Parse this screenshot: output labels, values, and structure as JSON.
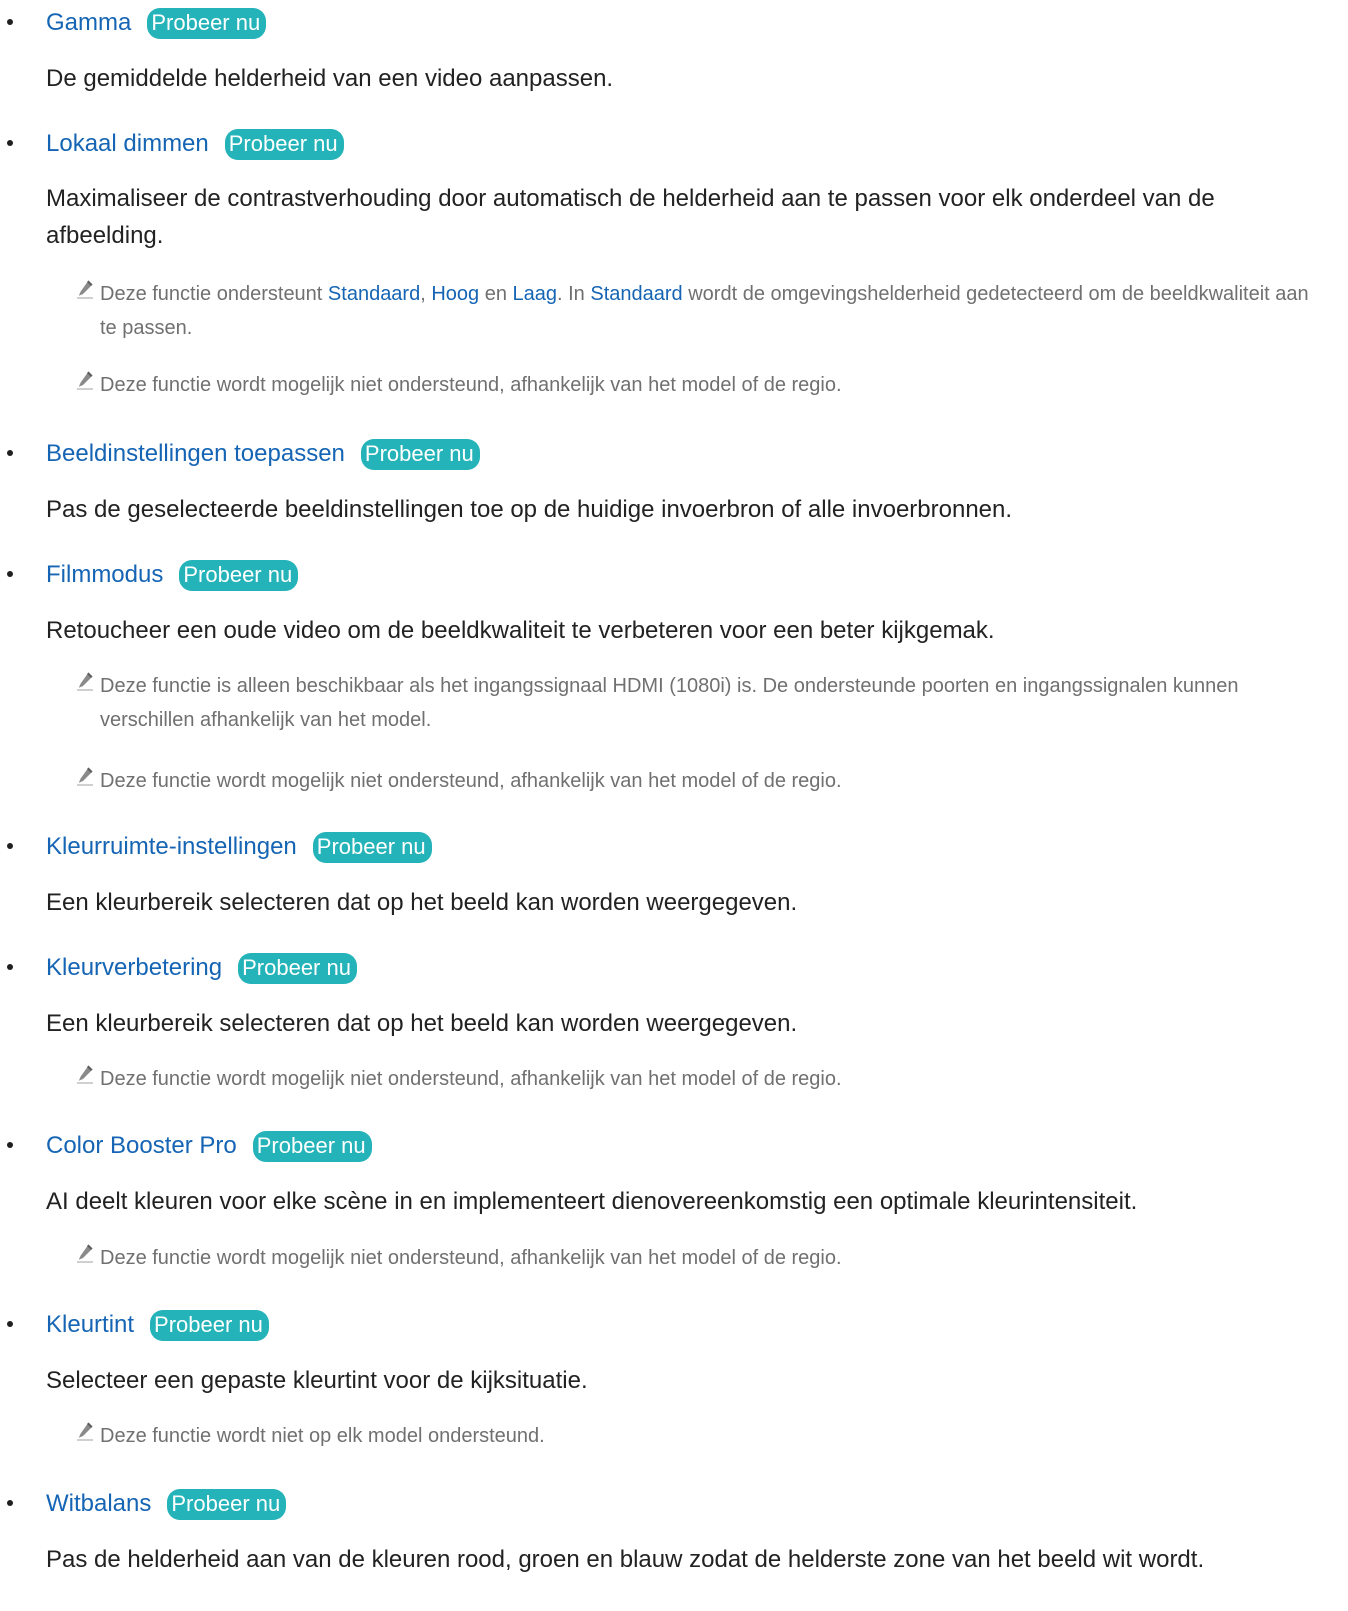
{
  "try_label": "Probeer nu",
  "icons": {
    "note": "pencil-note-icon",
    "bullet": "bullet-dot"
  },
  "colors": {
    "title": "#1565b4",
    "try_badge": "#23b3b8",
    "note_text": "#707070",
    "body_text": "#222222"
  },
  "items": [
    {
      "title": "Gamma",
      "desc": "De gemiddelde helderheid van een video aanpassen."
    },
    {
      "title": "Lokaal dimmen",
      "desc": "Maximaliseer de contrastverhouding door automatisch de helderheid aan te passen voor elk onderdeel van de afbeelding.",
      "note1": {
        "p1": "Deze functie ondersteunt ",
        "h1": "Standaard",
        "p2": ", ",
        "h2": "Hoog",
        "p3": " en ",
        "h3": "Laag",
        "p4": ". In ",
        "h4": "Standaard",
        "p5": " wordt de omgevingshelderheid gedetecteerd om de beeldkwaliteit aan te passen."
      },
      "note2": "Deze functie wordt mogelijk niet ondersteund, afhankelijk van het model of de regio."
    },
    {
      "title": "Beeldinstellingen toepassen",
      "desc": "Pas de geselecteerde beeldinstellingen toe op de huidige invoerbron of alle invoerbronnen."
    },
    {
      "title": "Filmmodus",
      "desc": "Retoucheer een oude video om de beeldkwaliteit te verbeteren voor een beter kijkgemak.",
      "note1": "Deze functie is alleen beschikbaar als het ingangssignaal HDMI (1080i) is. De ondersteunde poorten en ingangssignalen kunnen verschillen afhankelijk van het model.",
      "note2": "Deze functie wordt mogelijk niet ondersteund, afhankelijk van het model of de regio."
    },
    {
      "title": "Kleurruimte-instellingen",
      "desc": "Een kleurbereik selecteren dat op het beeld kan worden weergegeven."
    },
    {
      "title": "Kleurverbetering",
      "desc": "Een kleurbereik selecteren dat op het beeld kan worden weergegeven.",
      "note1": "Deze functie wordt mogelijk niet ondersteund, afhankelijk van het model of de regio."
    },
    {
      "title": "Color Booster Pro",
      "desc": "AI deelt kleuren voor elke scène in en implementeert dienovereenkomstig een optimale kleurintensiteit.",
      "note1": "Deze functie wordt mogelijk niet ondersteund, afhankelijk van het model of de regio."
    },
    {
      "title": "Kleurtint",
      "desc": "Selecteer een gepaste kleurtint voor de kijksituatie.",
      "note1": "Deze functie wordt niet op elk model ondersteund."
    },
    {
      "title": "Witbalans",
      "desc": "Pas de helderheid aan van de kleuren rood, groen en blauw zodat de helderste zone van het beeld wit wordt."
    }
  ]
}
